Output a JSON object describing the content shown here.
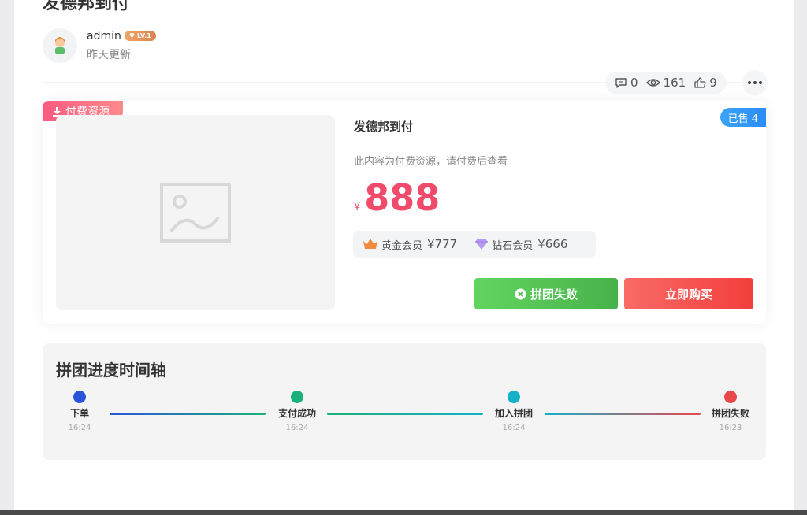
{
  "post": {
    "title": "发德邦到付"
  },
  "author": {
    "name": "admin",
    "level": "LV.1",
    "updated": "昨天更新"
  },
  "stats": {
    "comments": "0",
    "views": "161",
    "likes": "9"
  },
  "resource": {
    "tag": "付费资源",
    "title": "发德邦到付",
    "sold": "已售 4",
    "description": "此内容为付费资源，请付费后查看",
    "currency": "¥",
    "price": "888",
    "vip": [
      {
        "name": "黄金会员",
        "price": "¥777",
        "icon": "crown-icon"
      },
      {
        "name": "钻石会员",
        "price": "¥666",
        "icon": "diamond-icon"
      }
    ],
    "buttons": {
      "group_fail": "拼团失败",
      "buy_now": "立即购买"
    }
  },
  "timeline": {
    "title": "拼团进度时间轴",
    "steps": [
      {
        "label": "下单",
        "time": "16:24",
        "color": "#2a55d8"
      },
      {
        "label": "支付成功",
        "time": "16:24",
        "color": "#1ab07a"
      },
      {
        "label": "加入拼团",
        "time": "16:24",
        "color": "#13b0c8"
      },
      {
        "label": "拼团失败",
        "time": "16:23",
        "color": "#e8474c"
      }
    ]
  }
}
